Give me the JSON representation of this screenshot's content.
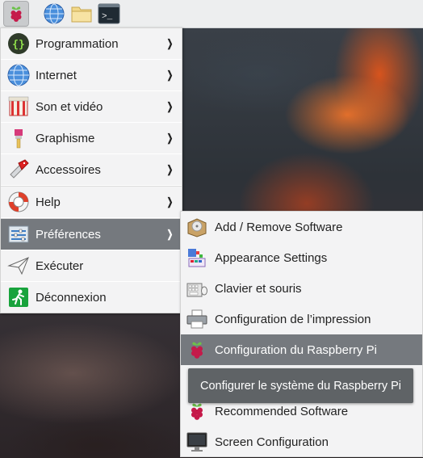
{
  "panel": {
    "launchers": [
      {
        "name": "raspberry-menu-icon"
      },
      {
        "name": "globe-icon"
      },
      {
        "name": "folder-icon"
      },
      {
        "name": "terminal-icon",
        "glyph": ">_"
      }
    ]
  },
  "menu": {
    "items": [
      {
        "label": "Programmation",
        "icon": "code-braces-icon"
      },
      {
        "label": "Internet",
        "icon": "globe-icon"
      },
      {
        "label": "Son et vidéo",
        "icon": "film-icon"
      },
      {
        "label": "Graphisme",
        "icon": "paintbrush-icon"
      },
      {
        "label": "Accessoires",
        "icon": "pocketknife-icon"
      },
      {
        "label": "Help",
        "icon": "lifebuoy-icon"
      },
      {
        "label": "Préférences",
        "icon": "sliders-icon"
      },
      {
        "label": "Exécuter",
        "icon": "paper-plane-icon"
      },
      {
        "label": "Déconnexion",
        "icon": "exit-icon"
      }
    ],
    "arrow": "❯"
  },
  "submenu": {
    "items": [
      {
        "label": "Add / Remove Software",
        "icon": "package-icon"
      },
      {
        "label": "Appearance Settings",
        "icon": "palette-icon"
      },
      {
        "label": "Clavier et souris",
        "icon": "keyboard-icon"
      },
      {
        "label": "Configuration de l’impression",
        "icon": "printer-icon"
      },
      {
        "label": "Configuration du Raspberry Pi",
        "icon": "raspberry-icon"
      },
      {
        "label": "",
        "icon": ""
      },
      {
        "label": "Recommended Software",
        "icon": "raspberry-icon"
      },
      {
        "label": "Screen Configuration",
        "icon": "monitor-icon"
      }
    ]
  },
  "tooltip": {
    "text": "Configurer le système du Raspberry Pi"
  },
  "colors": {
    "panel_bg": "#edeeef",
    "menu_bg": "#f3f3f4",
    "selection": "#75797e",
    "raspberry_red": "#c51a4a",
    "leaf_green": "#6cc04a"
  }
}
